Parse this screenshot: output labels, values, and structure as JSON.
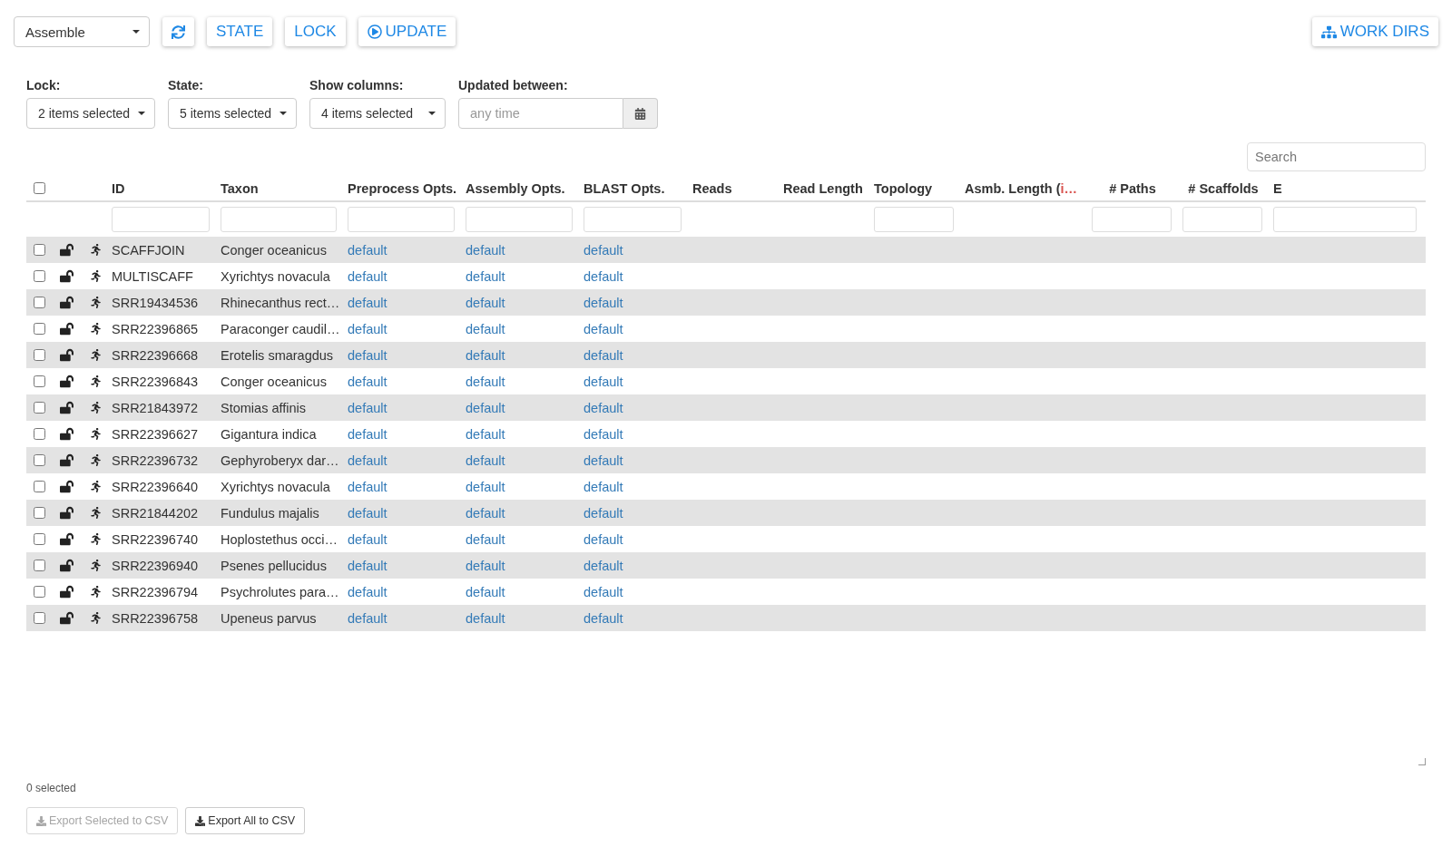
{
  "toolbar": {
    "mode": "Assemble",
    "buttons": [
      {
        "kind": "refresh"
      },
      {
        "kind": "text",
        "label": "STATE"
      },
      {
        "kind": "text",
        "label": "LOCK"
      },
      {
        "kind": "play",
        "label": "UPDATE"
      }
    ],
    "work_dirs": "WORK DIRS"
  },
  "filters": [
    {
      "label": "Lock:",
      "value": "2 items selected"
    },
    {
      "label": "State:",
      "value": "5 items selected"
    },
    {
      "label": "Show columns:",
      "value": "4 items selected"
    }
  ],
  "updated": {
    "label": "Updated between:",
    "placeholder": "any time"
  },
  "search": {
    "placeholder": "Search"
  },
  "table": {
    "header_checked": false,
    "columns": [
      {
        "label": "ID",
        "filter": true
      },
      {
        "label": "Taxon",
        "filter": true
      },
      {
        "label": "Preprocess Opts.",
        "filter": true
      },
      {
        "label": "Assembly Opts.",
        "filter": true
      },
      {
        "label": "BLAST Opts.",
        "filter": true
      },
      {
        "label": "Reads",
        "filter": false
      },
      {
        "label": "Read Length",
        "filter": false
      },
      {
        "label": "Topology",
        "filter": true
      },
      {
        "label": "Asmb. Length (",
        "marker": "i…",
        "filter": false
      },
      {
        "label": "# Paths",
        "filter": true
      },
      {
        "label": "# Scaffolds",
        "filter": true
      },
      {
        "label": "E",
        "filter": true
      }
    ],
    "rows": [
      {
        "checked": false,
        "id": "SCAFFJOIN",
        "taxon": "Conger oceanicus",
        "preprocess": "default",
        "assembly": "default",
        "blast": "default"
      },
      {
        "checked": false,
        "id": "MULTISCAFF",
        "taxon": "Xyrichtys novacula",
        "preprocess": "default",
        "assembly": "default",
        "blast": "default"
      },
      {
        "checked": false,
        "id": "SRR19434536",
        "taxon": "Rhinecanthus rect…",
        "preprocess": "default",
        "assembly": "default",
        "blast": "default"
      },
      {
        "checked": false,
        "id": "SRR22396865",
        "taxon": "Paraconger caudil…",
        "preprocess": "default",
        "assembly": "default",
        "blast": "default"
      },
      {
        "checked": false,
        "id": "SRR22396668",
        "taxon": "Erotelis smaragdus",
        "preprocess": "default",
        "assembly": "default",
        "blast": "default"
      },
      {
        "checked": false,
        "id": "SRR22396843",
        "taxon": "Conger oceanicus",
        "preprocess": "default",
        "assembly": "default",
        "blast": "default"
      },
      {
        "checked": false,
        "id": "SRR21843972",
        "taxon": "Stomias affinis",
        "preprocess": "default",
        "assembly": "default",
        "blast": "default"
      },
      {
        "checked": false,
        "id": "SRR22396627",
        "taxon": "Gigantura indica",
        "preprocess": "default",
        "assembly": "default",
        "blast": "default"
      },
      {
        "checked": false,
        "id": "SRR22396732",
        "taxon": "Gephyroberyx dar…",
        "preprocess": "default",
        "assembly": "default",
        "blast": "default"
      },
      {
        "checked": false,
        "id": "SRR22396640",
        "taxon": "Xyrichtys novacula",
        "preprocess": "default",
        "assembly": "default",
        "blast": "default"
      },
      {
        "checked": false,
        "id": "SRR21844202",
        "taxon": "Fundulus majalis",
        "preprocess": "default",
        "assembly": "default",
        "blast": "default"
      },
      {
        "checked": false,
        "id": "SRR22396740",
        "taxon": "Hoplostethus occi…",
        "preprocess": "default",
        "assembly": "default",
        "blast": "default"
      },
      {
        "checked": false,
        "id": "SRR22396940",
        "taxon": "Psenes pellucidus",
        "preprocess": "default",
        "assembly": "default",
        "blast": "default"
      },
      {
        "checked": false,
        "id": "SRR22396794",
        "taxon": "Psychrolutes para…",
        "preprocess": "default",
        "assembly": "default",
        "blast": "default"
      },
      {
        "checked": false,
        "id": "SRR22396758",
        "taxon": "Upeneus parvus",
        "preprocess": "default",
        "assembly": "default",
        "blast": "default"
      }
    ]
  },
  "footer": {
    "selected": "0 selected",
    "buttons": [
      {
        "label": "Export Selected to CSV",
        "disabled": true
      },
      {
        "label": "Export All to CSV",
        "disabled": false
      }
    ]
  }
}
